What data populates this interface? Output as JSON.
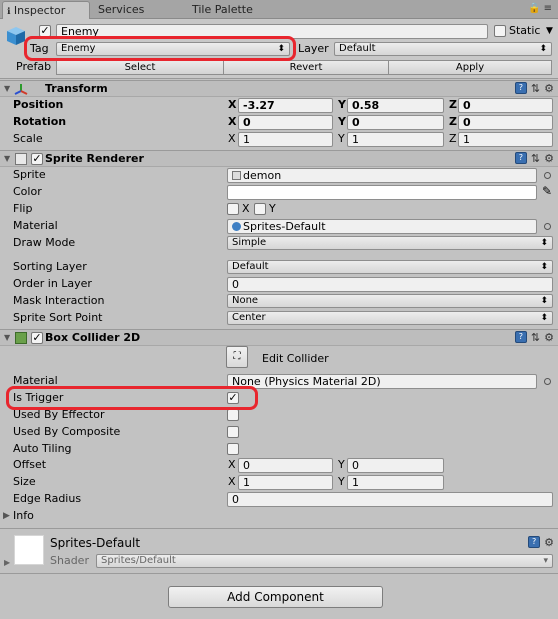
{
  "tabs": [
    {
      "label": "Inspector"
    },
    {
      "label": "Services"
    },
    {
      "label": "Tile Palette"
    }
  ],
  "gameobject": {
    "name": "Enemy",
    "static_label": "Static",
    "tag_label": "Tag",
    "tag_value": "Enemy",
    "layer_label": "Layer",
    "layer_value": "Default",
    "prefab_label": "Prefab",
    "prefab_buttons": [
      "Select",
      "Revert",
      "Apply"
    ]
  },
  "transform": {
    "title": "Transform",
    "rows": [
      {
        "label": "Position",
        "x": "-3.27",
        "y": "0.58",
        "z": "0"
      },
      {
        "label": "Rotation",
        "x": "0",
        "y": "0",
        "z": "0"
      },
      {
        "label": "Scale",
        "x": "1",
        "y": "1",
        "z": "1"
      }
    ]
  },
  "sprite_renderer": {
    "title": "Sprite Renderer",
    "sprite_label": "Sprite",
    "sprite_value": "demon",
    "color_label": "Color",
    "flip_label": "Flip",
    "flip_x": "X",
    "flip_y": "Y",
    "material_label": "Material",
    "material_value": "Sprites-Default",
    "draw_mode_label": "Draw Mode",
    "draw_mode_value": "Simple",
    "sorting_layer_label": "Sorting Layer",
    "sorting_layer_value": "Default",
    "order_label": "Order in Layer",
    "order_value": "0",
    "mask_label": "Mask Interaction",
    "mask_value": "None",
    "sort_point_label": "Sprite Sort Point",
    "sort_point_value": "Center"
  },
  "box_collider": {
    "title": "Box Collider 2D",
    "edit_collider_label": "Edit Collider",
    "material_label": "Material",
    "material_value": "None (Physics Material 2D)",
    "is_trigger_label": "Is Trigger",
    "used_by_effector_label": "Used By Effector",
    "used_by_composite_label": "Used By Composite",
    "auto_tiling_label": "Auto Tiling",
    "offset_label": "Offset",
    "offset_x": "0",
    "offset_y": "0",
    "size_label": "Size",
    "size_x": "1",
    "size_y": "1",
    "edge_radius_label": "Edge Radius",
    "edge_radius_value": "0",
    "info_label": "Info"
  },
  "material_section": {
    "name": "Sprites-Default",
    "shader_label": "Shader",
    "shader_value": "Sprites/Default"
  },
  "add_component_label": "Add Component",
  "axis_labels": {
    "x": "X",
    "y": "Y",
    "z": "Z"
  },
  "colors": {
    "highlight": "#e8262e",
    "panel": "#c2c2c2"
  }
}
